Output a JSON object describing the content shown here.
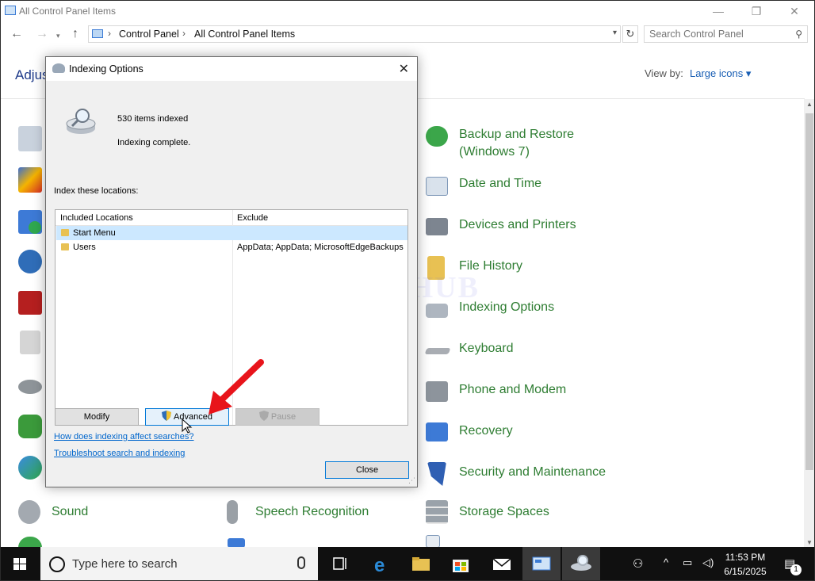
{
  "window": {
    "title": "All Control Panel Items",
    "controls": {
      "minimize": "—",
      "maximize": "❐",
      "close": "✕"
    }
  },
  "address_bar": {
    "crumbs": [
      "Control Panel",
      "All Control Panel Items"
    ],
    "separator": "›",
    "search_placeholder": "Search Control Panel"
  },
  "page": {
    "heading_partial": "Adjus",
    "view_by_label": "View by:",
    "view_by_value": "Large icons ▾"
  },
  "items": [
    {
      "label": "Backup and Restore",
      "label2": "(Windows 7)",
      "icon": "backup-restore-icon"
    },
    {
      "label": "Date and Time",
      "icon": "date-time-icon"
    },
    {
      "label": "Devices and Printers",
      "icon": "devices-printers-icon"
    },
    {
      "label": "File History",
      "icon": "file-history-icon"
    },
    {
      "label": "Indexing Options",
      "icon": "indexing-options-icon"
    },
    {
      "label": "Keyboard",
      "icon": "keyboard-icon"
    },
    {
      "label": "Phone and Modem",
      "icon": "phone-modem-icon"
    },
    {
      "label": "Recovery",
      "icon": "recovery-icon"
    },
    {
      "label": "Security and Maintenance",
      "icon": "security-maintenance-icon"
    },
    {
      "label": "Storage Spaces",
      "icon": "storage-spaces-icon"
    },
    {
      "label": "Sound",
      "icon": "sound-icon"
    },
    {
      "label": "Speech Recognition",
      "icon": "speech-recognition-icon"
    }
  ],
  "dialog": {
    "title": "Indexing Options",
    "items_indexed": "530 items indexed",
    "status": "Indexing complete.",
    "index_label": "Index these locations:",
    "columns": [
      "Included Locations",
      "Exclude"
    ],
    "rows": [
      {
        "location": "Start Menu",
        "exclude": "",
        "selected": true
      },
      {
        "location": "Users",
        "exclude": "AppData; AppData; MicrosoftEdgeBackups",
        "selected": false
      }
    ],
    "buttons": {
      "modify": "Modify",
      "advanced": "Advanced",
      "pause": "Pause",
      "close": "Close"
    },
    "links": {
      "how": "How does indexing affect searches?",
      "troubleshoot": "Troubleshoot search and indexing"
    }
  },
  "watermark": "IT Pros HUB",
  "taskbar": {
    "search_text": "Type here to search",
    "time": "11:53 PM",
    "date": "6/15/2025",
    "notification_count": "1"
  },
  "colors": {
    "accent": "#0078d7",
    "item_text": "#2e7d32",
    "arrow": "#e8141b"
  }
}
